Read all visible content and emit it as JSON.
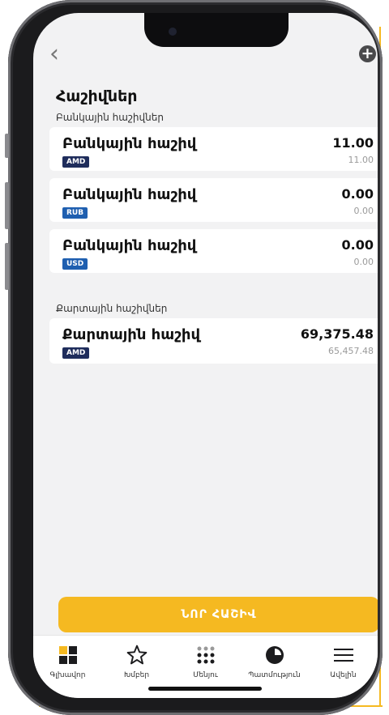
{
  "header": {
    "back_icon": "chevron-left-icon",
    "add_icon": "plus-circle-icon",
    "title": "Հաշիվներ"
  },
  "sections": [
    {
      "label": "Բանկային հաշիվներ",
      "accounts": [
        {
          "name": "Բանկային հաշիվ",
          "currency": "AMD",
          "amount": "11.00",
          "equivalent": "11.00"
        },
        {
          "name": "Բանկային հաշիվ",
          "currency": "RUB",
          "amount": "0.00",
          "equivalent": "0.00"
        },
        {
          "name": "Բանկային հաշիվ",
          "currency": "USD",
          "amount": "0.00",
          "equivalent": "0.00"
        }
      ]
    },
    {
      "label": "Քարտային հաշիվներ",
      "accounts": [
        {
          "name": "Քարտային հաշիվ",
          "currency": "AMD",
          "amount": "69,375.48",
          "equivalent": "65,457.48"
        }
      ]
    }
  ],
  "new_account_button": "ՆՈՐ ՀԱՇԻՎ",
  "tabs": [
    {
      "label": "Գլխավոր",
      "icon": "grid-icon"
    },
    {
      "label": "Խմբեր",
      "icon": "star-icon"
    },
    {
      "label": "Մենյու",
      "icon": "dots-grid-icon"
    },
    {
      "label": "Պատմություն",
      "icon": "pie-chart-icon"
    },
    {
      "label": "Ավելին",
      "icon": "hamburger-menu-icon"
    }
  ],
  "colors": {
    "accent": "#f5b921",
    "badge_amd": "#1f2d5c",
    "badge_rub": "#1f5fb0",
    "badge_usd": "#1f5fb0"
  }
}
